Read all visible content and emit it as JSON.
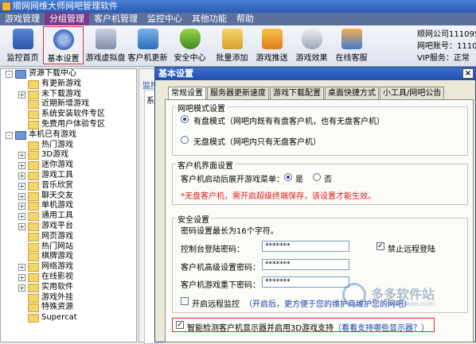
{
  "window": {
    "title": "顺网网维大师网吧管理软件"
  },
  "menu": [
    "游戏管理",
    "分组管理",
    "客户机管理",
    "监控中心",
    "其他功能",
    "帮助"
  ],
  "toolbar": [
    {
      "label": "监控首页",
      "icon": "monitor-chart-icon"
    },
    {
      "label": "基本设置",
      "icon": "gear-icon"
    },
    {
      "label": "游戏虚拟盘",
      "icon": "disk-icon"
    },
    {
      "label": "客户机更新",
      "icon": "computer-update-icon"
    },
    {
      "label": "安全中心",
      "icon": "shield-icon"
    },
    {
      "label": "批量添加",
      "icon": "folder-add-icon"
    },
    {
      "label": "游戏推送",
      "icon": "push-icon"
    },
    {
      "label": "游戏效果",
      "icon": "gamepad-icon"
    },
    {
      "label": "在线客服",
      "icon": "chat-icon"
    }
  ],
  "user_info": {
    "line1": "顺网公司111095",
    "line2": "网吧账号：1110",
    "line3": "VIP服务：正常"
  },
  "tree": [
    {
      "label": "资源下载中心",
      "level": 0,
      "exp": "-",
      "icon": "folder-blue"
    },
    {
      "label": "有更新游戏",
      "level": 1,
      "exp": "",
      "icon": "folder"
    },
    {
      "label": "未下载游戏",
      "level": 1,
      "exp": "+",
      "icon": "folder"
    },
    {
      "label": "近期新增游戏",
      "level": 1,
      "exp": "",
      "icon": "folder"
    },
    {
      "label": "系统安装软件专区",
      "level": 1,
      "exp": "",
      "icon": "folder"
    },
    {
      "label": "免费用户体验专区",
      "level": 1,
      "exp": "",
      "icon": "folder"
    },
    {
      "label": "本机已有游戏",
      "level": 0,
      "exp": "-",
      "icon": "folder-blue"
    },
    {
      "label": "热门游戏",
      "level": 1,
      "exp": "",
      "icon": "folder"
    },
    {
      "label": "3D游戏",
      "level": 1,
      "exp": "+",
      "icon": "folder"
    },
    {
      "label": "迷你游戏",
      "level": 1,
      "exp": "+",
      "icon": "folder"
    },
    {
      "label": "游戏工具",
      "level": 1,
      "exp": "+",
      "icon": "folder"
    },
    {
      "label": "音乐欣赏",
      "level": 1,
      "exp": "+",
      "icon": "folder"
    },
    {
      "label": "聊天交友",
      "level": 1,
      "exp": "+",
      "icon": "folder"
    },
    {
      "label": "单机游戏",
      "level": 1,
      "exp": "+",
      "icon": "folder"
    },
    {
      "label": "通用工具",
      "level": 1,
      "exp": "+",
      "icon": "folder"
    },
    {
      "label": "游戏平台",
      "level": 1,
      "exp": "+",
      "icon": "folder"
    },
    {
      "label": "网页游戏",
      "level": 1,
      "exp": "",
      "icon": "folder"
    },
    {
      "label": "热门网站",
      "level": 1,
      "exp": "",
      "icon": "folder"
    },
    {
      "label": "棋牌游戏",
      "level": 1,
      "exp": "",
      "icon": "folder"
    },
    {
      "label": "网络游戏",
      "level": 1,
      "exp": "+",
      "icon": "folder"
    },
    {
      "label": "在线影视",
      "level": 1,
      "exp": "+",
      "icon": "folder"
    },
    {
      "label": "实用软件",
      "level": 1,
      "exp": "+",
      "icon": "folder"
    },
    {
      "label": "游戏外挂",
      "level": 1,
      "exp": "",
      "icon": "folder"
    },
    {
      "label": "特殊资源",
      "level": 1,
      "exp": "",
      "icon": "folder"
    },
    {
      "label": "Supercat",
      "level": 1,
      "exp": "",
      "icon": "folder"
    }
  ],
  "bg_panel": {
    "tab": "监控",
    "inner": "系"
  },
  "dialog": {
    "title": "基本设置",
    "close": "×",
    "tabs": [
      "常规设置",
      "服务器更新速度",
      "游戏下载配置",
      "桌面快捷方式",
      "小工具/网吧公告"
    ],
    "mode_group": {
      "title": "网吧模式设置",
      "option1": "有盘模式（网吧内既有有盘客户机，也有无盘客户机）",
      "option2": "无盘模式（网吧内只有无盘客户机）"
    },
    "client_group": {
      "title": "客户机界面设置",
      "label": "客户机启动后展开游戏菜单：",
      "yes": "是",
      "no": "否",
      "note": "*无盘客户机，需开启超级终端保存，该设置才能生效。"
    },
    "security_group": {
      "title": "安全设置",
      "hint": "密码设置最长为16个字符。",
      "console_label": "控制台登陆密码：",
      "console_value": "*******",
      "remote_disable": "禁止远程登陆",
      "adv_label": "客户机高级设置密码：",
      "adv_value": "*******",
      "reload_label": "客户机游戏重下密码：",
      "reload_value": "*******",
      "remote_monitor": "开启远程监控",
      "remote_note": "（开启后，更方便于您的维护商维护您的网吧）"
    },
    "detect_3d": "智能检测客户机显示器并启用3D游戏支持",
    "detect_3d_link": "（看看支持哪些显示器？）"
  },
  "watermark": {
    "text": "多多软件站",
    "sub": "www.ddooo.com"
  },
  "colors": {
    "titlebar": "#2a5bb5",
    "menubar": "#5b6f9e",
    "highlight": "#d93030",
    "note_red": "#e01818",
    "link_blue": "#1c3fa8"
  }
}
